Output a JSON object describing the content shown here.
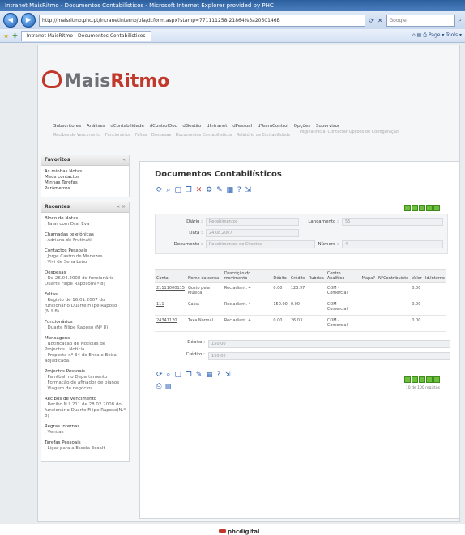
{
  "window": {
    "title": "Intranet MaisRitmo - Documentos Contabilísticos - Microsoft Internet Explorer provided by PHC",
    "address": "http://maisritmo.phc.pt/intranetinterno/pla/dcform.aspx?stamp=771111258-21864%3a2050146B",
    "search_placeholder": "Google",
    "tab_label": "Intranet MaisRitmo - Documentos Contabilísticos",
    "tools_label": "Page ▾  Tools ▾"
  },
  "brand": {
    "name_prefix": "Mais",
    "name_accent": "Ritmo",
    "accent_color": "#c0392b"
  },
  "topnav": [
    "Subscritores",
    "Análises",
    "dContabilidade",
    "dControlDoc",
    "dGestão",
    "dIntranet",
    "dPessoal",
    "dTeamControl",
    "Opções",
    "Supervisor"
  ],
  "subnav": [
    "Recibos de Vencimento",
    "Funcionários",
    "Faltas",
    "Despesas",
    "Documentos Contabilísticos",
    "Relatório de Contabilidade"
  ],
  "right_links": "Página Inicial   Contactar   Opções de Configuração",
  "favoritos": {
    "title": "Favoritos",
    "items": [
      "As minhas Notas",
      "Meus contactos",
      "Minhas Tarefas",
      "Parâmetros"
    ]
  },
  "recentes": {
    "title": "Recentes",
    "groups": [
      {
        "title": "Bloco de Notas",
        "items": [
          ". Falar com Dra. Eva"
        ]
      },
      {
        "title": "Chamadas telefónicas",
        "items": [
          ". Adriana de Frutinati"
        ]
      },
      {
        "title": "Contactos Pessoais",
        "items": [
          ". Jorge Castro de Menezes",
          ". Vivi de Sena Leão"
        ]
      },
      {
        "title": "Despesas",
        "items": [
          ". De 26.04.2008 do funcionário Duarte Filipe Raposo(N.º 8)"
        ]
      },
      {
        "title": "Faltas",
        "items": [
          ". Registo de 16.01.2007 do funcionário Duarte Filipe Raposo (N.º 8)"
        ]
      },
      {
        "title": "Funcionários",
        "items": [
          ". Duarte Filipe Raposo (Nº 8)"
        ]
      },
      {
        "title": "Mensagens",
        "items": [
          ". Notificação de Notícias de Projectos...Notícia",
          ". Proposta nº 34 de Ensa e Beira adjudicada."
        ]
      },
      {
        "title": "Projectos Pessoais",
        "items": [
          ". Paintball no Departamento",
          ". Formação de afinador de pianos",
          ". Viagem de negócios"
        ]
      },
      {
        "title": "Recibos de Vencimento",
        "items": [
          ". Recibo N.º 211 de 28.02.2008 do funcionário Duarte Filipe Raposo(N.º 8)"
        ]
      },
      {
        "title": "Regras Internas",
        "items": [
          ". Vendas"
        ]
      },
      {
        "title": "Tarefas Pessoais",
        "items": [
          ". Ligar para a Escola Ecoalt"
        ]
      }
    ]
  },
  "main": {
    "title": "Documentos Contabilísticos",
    "pager_text": "10 de 100 registos",
    "form": {
      "diario_label": "Diário :",
      "diario_value": "Recebimentos",
      "lancamento_label": "Lançamento :",
      "lancamento_value": "56",
      "data_label": "Data :",
      "data_value": "24.08.2007",
      "documento_label": "Documento :",
      "documento_value": "Recebimentos de Clientes",
      "numero_label": "Número :",
      "numero_value": "4"
    },
    "table": {
      "headers": [
        "Conta",
        "Nome da conta",
        "Descrição do movimento",
        "Débito",
        "Crédito",
        "Rubrica",
        "Centro Analítico",
        "Mapa?",
        "N°Contribuinte",
        "Valor",
        "Id.Interno"
      ],
      "rows": [
        [
          "21111000115",
          "Gosto pela Música",
          "Rec.adiant. 4",
          "0.00",
          "123.97",
          "",
          "COM - Comercial",
          "",
          "",
          "0.00",
          ""
        ],
        [
          "111",
          "Caixa",
          "Rec.adiant. 4",
          "150.00",
          "0.00",
          "",
          "COM - Comercial",
          "",
          "",
          "0.00",
          ""
        ],
        [
          "24341120",
          "Taxa Normal",
          "Rec.adiant. 4",
          "0.00",
          "26.03",
          "",
          "COM - Comercial",
          "",
          "",
          "0.00",
          ""
        ]
      ]
    },
    "totals": {
      "debito_label": "Débito :",
      "debito_value": "150.00",
      "credito_label": "Crédito :",
      "credito_value": "150.00"
    }
  },
  "footer": {
    "brand": "phcdigital"
  }
}
